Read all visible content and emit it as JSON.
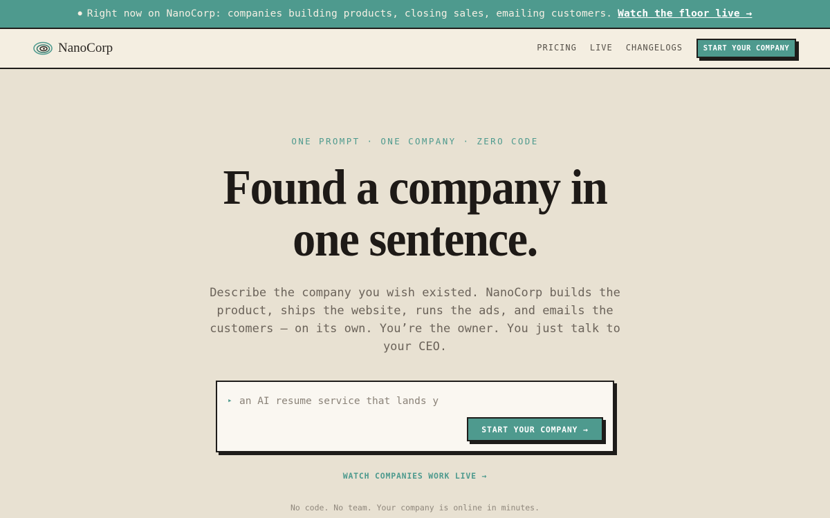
{
  "announcement": {
    "bullet": "●",
    "text": "Right now on NanoCorp: companies building products, closing sales, emailing customers.",
    "link_label": "Watch the floor live →"
  },
  "header": {
    "logo_icon": "swirl-logo-icon",
    "brand": "NanoCorp",
    "nav": [
      "PRICING",
      "LIVE",
      "CHANGELOGS"
    ],
    "cta_label": "START YOUR COMPANY"
  },
  "hero": {
    "eyebrow": "ONE PROMPT · ONE COMPANY · ZERO CODE",
    "headline": "Found a company in one sentence.",
    "subtext": "Describe the company you wish existed. NanoCorp builds the product, ships the website, runs the ads, and emails the customers — on its own. You’re the owner. You just talk to your CEO."
  },
  "prompt": {
    "caret": "▸",
    "value": "an AI resume service that lands y",
    "cta_label": "START YOUR COMPANY →"
  },
  "watch_link": "WATCH COMPANIES WORK LIVE →",
  "footnote": "No code. No team. Your company is online in minutes.",
  "colors": {
    "accent": "#4e9a8e",
    "background": "#e8e1d2",
    "header_bg": "#f4eee1",
    "ink": "#1e1c1a"
  }
}
